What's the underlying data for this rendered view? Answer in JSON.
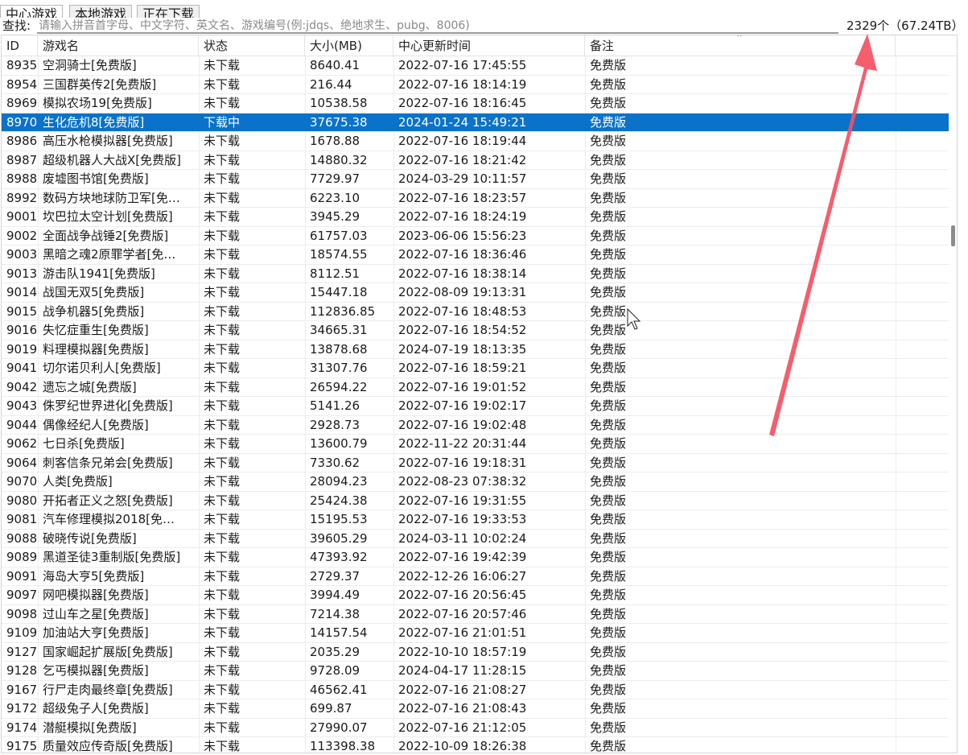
{
  "tabs": [
    "中心游戏",
    "本地游戏",
    "正在下载"
  ],
  "search": {
    "label": "查找:",
    "placeholder": "请输入拼音首字母、中文字符、英文名、游戏编号(例:jdqs、绝地求生、pubg、8006)"
  },
  "summary": {
    "count_text": "2329个（67.24TB）"
  },
  "table": {
    "columns": [
      "ID",
      "游戏名",
      "状态",
      "大小(MB)",
      "中心更新时间",
      "备注"
    ],
    "rows": [
      [
        "8935",
        "空洞骑士[免费版]",
        "未下载",
        "8640.41",
        "2022-07-16 17:45:55",
        "免费版"
      ],
      [
        "8954",
        "三国群英传2[免费版]",
        "未下载",
        "216.44",
        "2022-07-16 18:14:19",
        "免费版"
      ],
      [
        "8969",
        "模拟农场19[免费版]",
        "未下载",
        "10538.58",
        "2022-07-16 18:16:45",
        "免费版"
      ],
      [
        "8970",
        "生化危机8[免费版]",
        "下载中",
        "37675.38",
        "2024-01-24 15:49:21",
        "免费版"
      ],
      [
        "8986",
        "高压水枪模拟器[免费版]",
        "未下载",
        "1678.88",
        "2022-07-16 18:19:44",
        "免费版"
      ],
      [
        "8987",
        "超级机器人大战X[免费版]",
        "未下载",
        "14880.32",
        "2022-07-16 18:21:42",
        "免费版"
      ],
      [
        "8988",
        "废墟图书馆[免费版]",
        "未下载",
        "7729.97",
        "2024-03-29 10:11:57",
        "免费版"
      ],
      [
        "8992",
        "数码方块地球防卫军[免…",
        "未下载",
        "6223.10",
        "2022-07-16 18:23:57",
        "免费版"
      ],
      [
        "9001",
        "坎巴拉太空计划[免费版]",
        "未下载",
        "3945.29",
        "2022-07-16 18:24:19",
        "免费版"
      ],
      [
        "9002",
        "全面战争战锤2[免费版]",
        "未下载",
        "61757.03",
        "2023-06-06 15:56:23",
        "免费版"
      ],
      [
        "9003",
        "黑暗之魂2原罪学者[免…",
        "未下载",
        "18574.55",
        "2022-07-16 18:36:46",
        "免费版"
      ],
      [
        "9013",
        "游击队1941[免费版]",
        "未下载",
        "8112.51",
        "2022-07-16 18:38:14",
        "免费版"
      ],
      [
        "9014",
        "战国无双5[免费版]",
        "未下载",
        "15447.18",
        "2022-08-09 19:13:31",
        "免费版"
      ],
      [
        "9015",
        "战争机器5[免费版]",
        "未下载",
        "112836.85",
        "2022-07-16 18:48:53",
        "免费版"
      ],
      [
        "9016",
        "失忆症重生[免费版]",
        "未下载",
        "34665.31",
        "2022-07-16 18:54:52",
        "免费版"
      ],
      [
        "9019",
        "料理模拟器[免费版]",
        "未下载",
        "13878.68",
        "2024-07-19 18:13:35",
        "免费版"
      ],
      [
        "9041",
        "切尔诺贝利人[免费版]",
        "未下载",
        "31307.76",
        "2022-07-16 18:59:21",
        "免费版"
      ],
      [
        "9042",
        "遗忘之城[免费版]",
        "未下载",
        "26594.22",
        "2022-07-16 19:01:52",
        "免费版"
      ],
      [
        "9043",
        "侏罗纪世界进化[免费版]",
        "未下载",
        "5141.26",
        "2022-07-16 19:02:17",
        "免费版"
      ],
      [
        "9044",
        "偶像经纪人[免费版]",
        "未下载",
        "2928.73",
        "2022-07-16 19:02:48",
        "免费版"
      ],
      [
        "9062",
        "七日杀[免费版]",
        "未下载",
        "13600.79",
        "2022-11-22 20:31:44",
        "免费版"
      ],
      [
        "9064",
        "刺客信条兄弟会[免费版]",
        "未下载",
        "7330.62",
        "2022-07-16 19:18:31",
        "免费版"
      ],
      [
        "9070",
        "人类[免费版]",
        "未下载",
        "28094.23",
        "2022-08-23 07:38:32",
        "免费版"
      ],
      [
        "9080",
        "开拓者正义之怒[免费版]",
        "未下载",
        "25424.38",
        "2022-07-16 19:31:55",
        "免费版"
      ],
      [
        "9081",
        "汽车修理模拟2018[免…",
        "未下载",
        "15195.53",
        "2022-07-16 19:33:53",
        "免费版"
      ],
      [
        "9088",
        "破晓传说[免费版]",
        "未下载",
        "39605.29",
        "2024-03-11 10:02:24",
        "免费版"
      ],
      [
        "9089",
        "黑道圣徒3重制版[免费版]",
        "未下载",
        "47393.92",
        "2022-07-16 19:42:39",
        "免费版"
      ],
      [
        "9091",
        "海岛大亨5[免费版]",
        "未下载",
        "2729.37",
        "2022-12-26 16:06:27",
        "免费版"
      ],
      [
        "9097",
        "网吧模拟器[免费版]",
        "未下载",
        "3994.49",
        "2022-07-16 20:56:45",
        "免费版"
      ],
      [
        "9098",
        "过山车之星[免费版]",
        "未下载",
        "7214.38",
        "2022-07-16 20:57:46",
        "免费版"
      ],
      [
        "9109",
        "加油站大亨[免费版]",
        "未下载",
        "14157.54",
        "2022-07-16 21:01:51",
        "免费版"
      ],
      [
        "9127",
        "国家崛起扩展版[免费版]",
        "未下载",
        "2035.29",
        "2022-10-10 18:57:19",
        "免费版"
      ],
      [
        "9128",
        "乞丐模拟器[免费版]",
        "未下载",
        "9728.09",
        "2024-04-17 11:28:15",
        "免费版"
      ],
      [
        "9167",
        "行尸走肉最终章[免费版]",
        "未下载",
        "46562.41",
        "2022-07-16 21:08:27",
        "免费版"
      ],
      [
        "9172",
        "超级兔子人[免费版]",
        "未下载",
        "699.87",
        "2022-07-16 21:08:43",
        "免费版"
      ],
      [
        "9174",
        "潜艇模拟[免费版]",
        "未下载",
        "27990.07",
        "2022-07-16 21:12:05",
        "免费版"
      ],
      [
        "9175",
        "质量效应传奇版[免费版]",
        "未下载",
        "113398.38",
        "2022-10-09 18:26:38",
        "免费版"
      ]
    ],
    "selected_row_id": "8970"
  },
  "colors": {
    "selection": "#0a72c9",
    "annotation_arrow": "#f4505f"
  },
  "icons": {
    "sort": "sort-ascending-icon",
    "cursor": "mouse-cursor-icon",
    "arrow": "annotation-arrow-icon"
  }
}
